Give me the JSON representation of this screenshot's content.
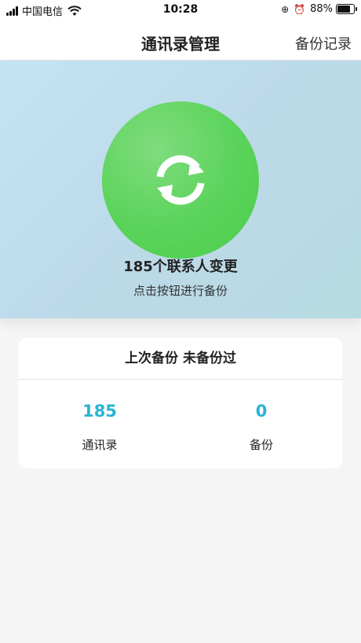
{
  "status_bar": {
    "carrier": "中国电信",
    "time": "10:28",
    "battery_percent": "88%",
    "battery_level": 0.88,
    "icons": [
      "signal-icon",
      "wifi-icon",
      "orientation-lock-icon",
      "alarm-icon",
      "battery-icon"
    ]
  },
  "nav": {
    "title": "通讯录管理",
    "action_label": "备份记录"
  },
  "hero": {
    "count_text": "185个联系人变更",
    "hint_text": "点击按钮进行备份",
    "button_icon": "sync-icon"
  },
  "summary": {
    "last_backup_label": "上次备份",
    "last_backup_value": "未备份过",
    "stats": [
      {
        "value": "185",
        "label": "通讯录"
      },
      {
        "value": "0",
        "label": "备份"
      }
    ]
  },
  "colors": {
    "accent_green": "#4ccc4a",
    "stat_blue": "#27b5d3",
    "hero_bg": "#c5e3f5"
  }
}
